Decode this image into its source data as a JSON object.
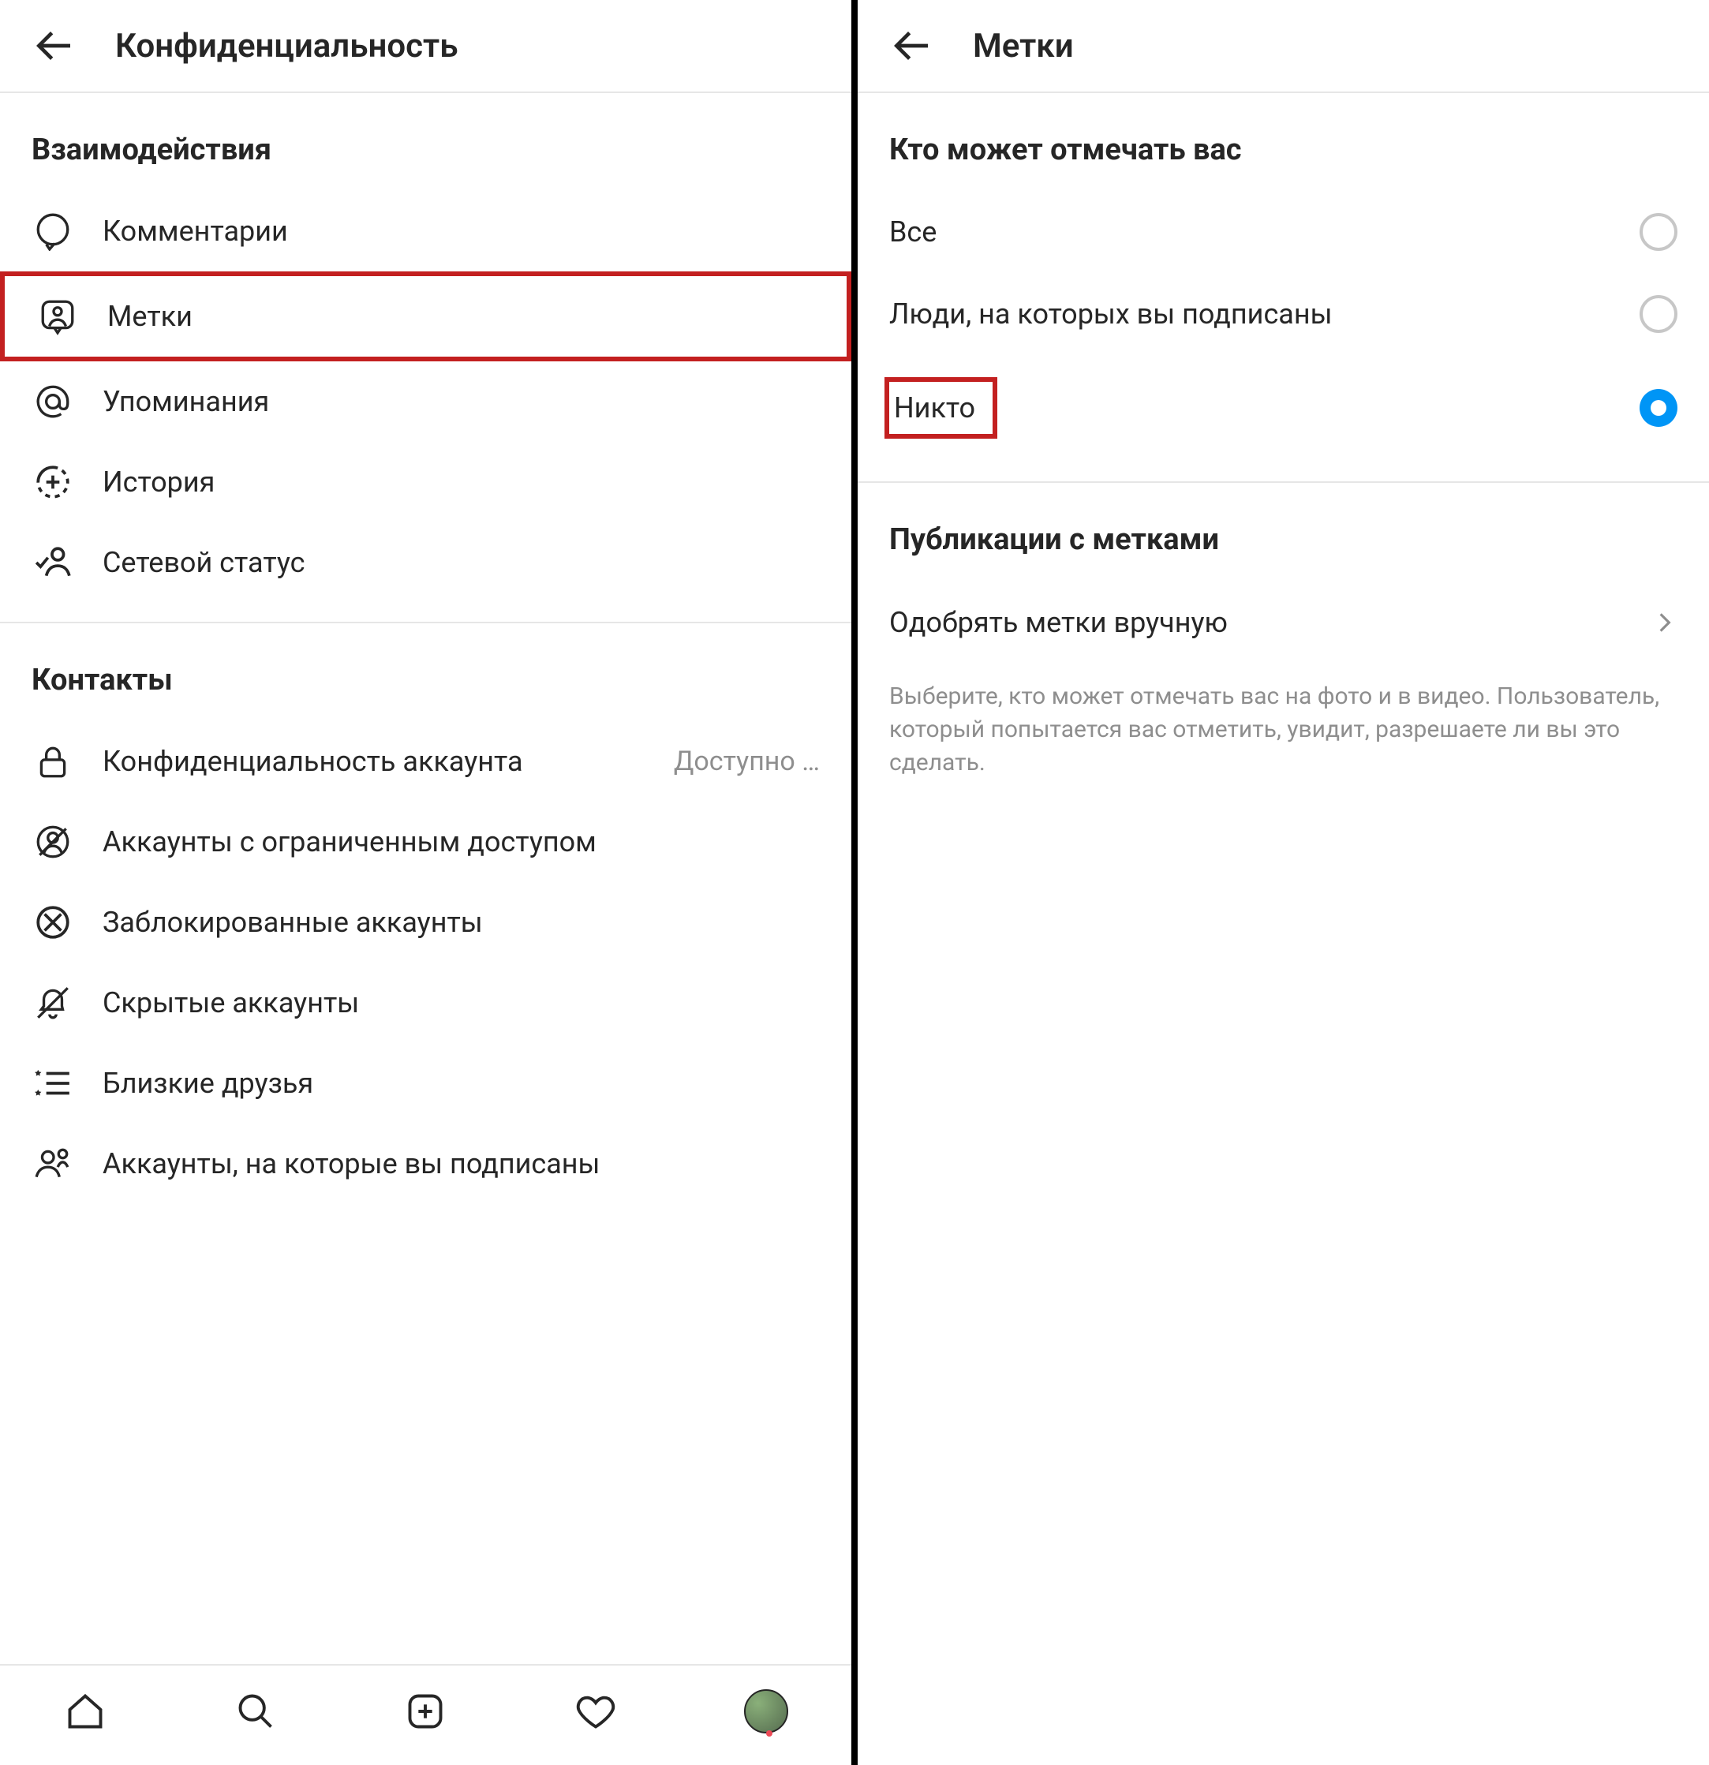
{
  "left": {
    "header": "Конфиденциальность",
    "section_interactions": "Взаимодействия",
    "items_interactions": [
      {
        "label": "Комментарии"
      },
      {
        "label": "Метки"
      },
      {
        "label": "Упоминания"
      },
      {
        "label": "История"
      },
      {
        "label": "Сетевой статус"
      }
    ],
    "section_contacts": "Контакты",
    "items_contacts": [
      {
        "label": "Конфиденциальность аккаунта",
        "secondary": "Доступно …"
      },
      {
        "label": "Аккаунты с ограниченным доступом"
      },
      {
        "label": "Заблокированные аккаунты"
      },
      {
        "label": "Скрытые аккаунты"
      },
      {
        "label": "Близкие друзья"
      },
      {
        "label": "Аккаунты, на которые вы подписаны"
      }
    ]
  },
  "right": {
    "header": "Метки",
    "section_who": "Кто может отмечать вас",
    "options": [
      {
        "label": "Все",
        "selected": false
      },
      {
        "label": "Люди, на которых вы подписаны",
        "selected": false
      },
      {
        "label": "Никто",
        "selected": true
      }
    ],
    "section_tagged": "Публикации с метками",
    "manual_approve": "Одобрять метки вручную",
    "help": "Выберите, кто может отмечать вас на фото и в видео. Пользователь, который попытается вас отметить, увидит, разрешаете ли вы это сделать."
  }
}
